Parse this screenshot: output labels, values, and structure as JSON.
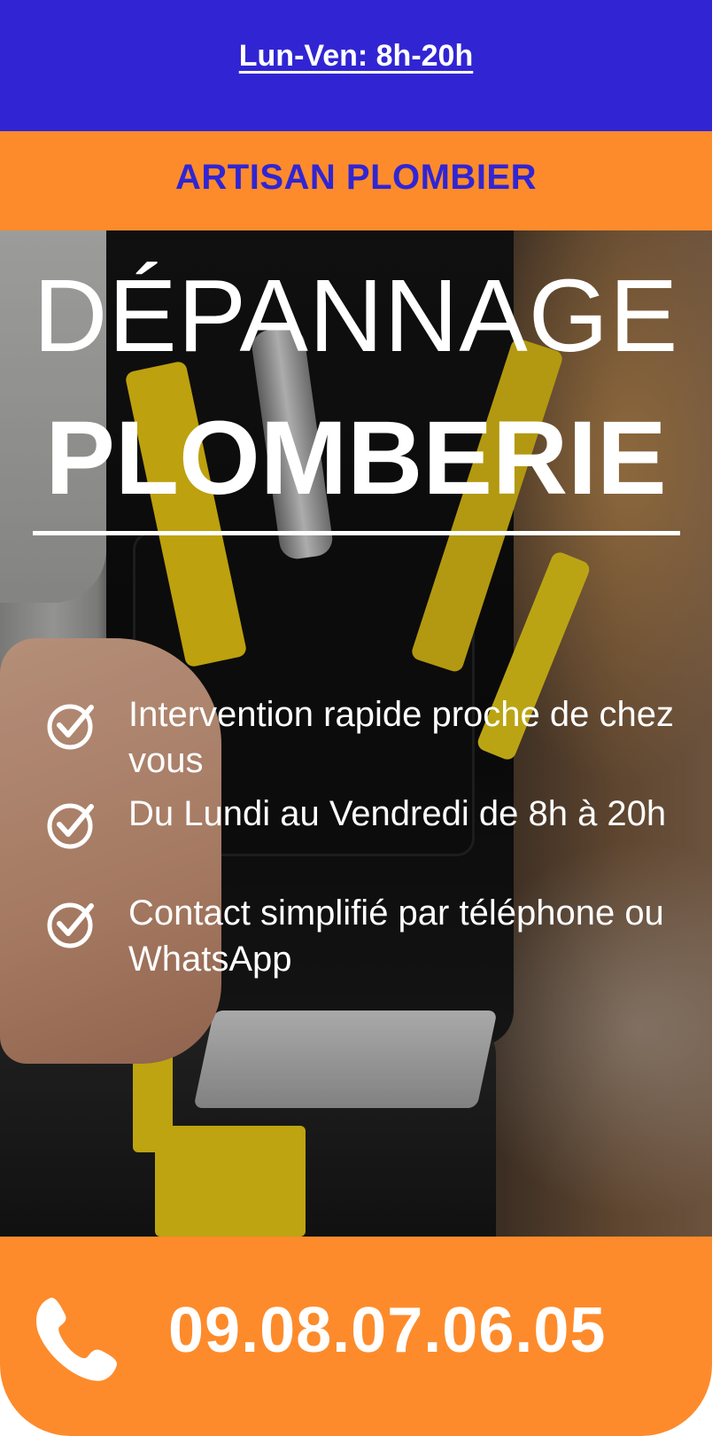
{
  "header": {
    "hours_link": "Lun-Ven: 8h-20h",
    "brand": "ARTISAN PLOMBIER"
  },
  "hero": {
    "title_line1": "DÉPANNAGE",
    "title_line2": "PLOMBERIE",
    "features": [
      "Intervention rapide proche de chez vous",
      "Du Lundi au Vendredi de 8h à 20h",
      "Contact simplifié par téléphone ou WhatsApp"
    ]
  },
  "cta": {
    "phone": "09.08.07.06.05",
    "icon": "phone-icon"
  },
  "colors": {
    "primary_blue": "#3125d3",
    "accent_orange": "#fd8b2b",
    "text_white": "#ffffff"
  }
}
